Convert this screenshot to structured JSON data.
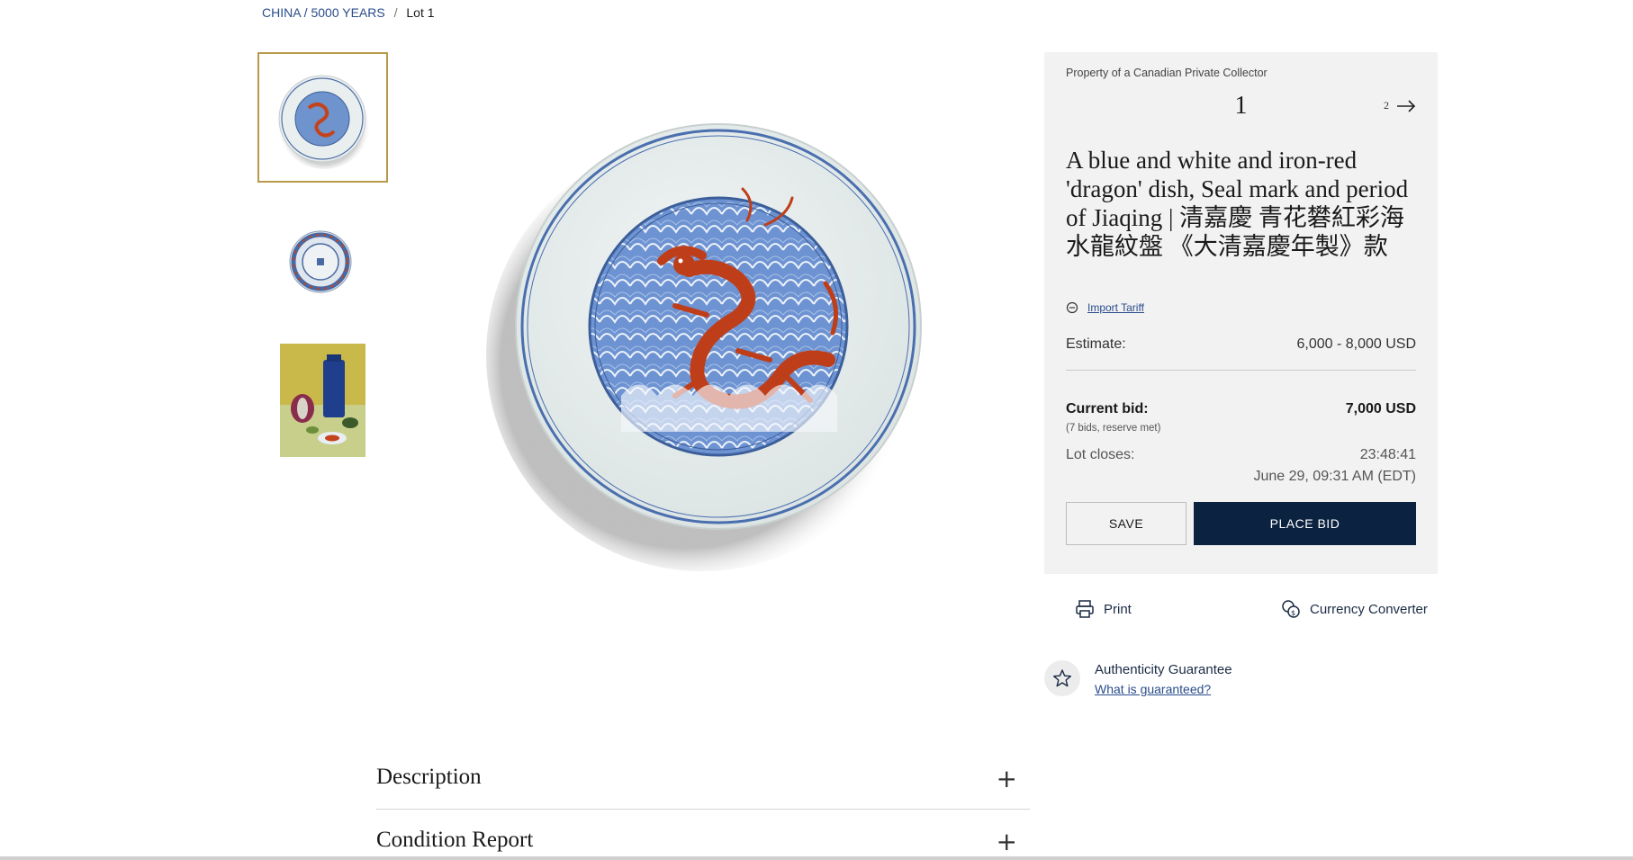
{
  "breadcrumb": {
    "sale": "CHINA / 5000 YEARS",
    "separator": "/",
    "current": "Lot 1"
  },
  "gallery": {
    "thumbnails": [
      {
        "name": "dish-front-thumbnail",
        "selected": true
      },
      {
        "name": "dish-back-thumbnail",
        "selected": false
      },
      {
        "name": "still-life-thumbnail",
        "selected": false
      }
    ]
  },
  "lot": {
    "provenance": "Property of a Canadian Private Collector",
    "number": "1",
    "next_number": "2",
    "title": "A blue and white and iron-red 'dragon' dish, Seal mark and period of Jiaqing | 清嘉慶 青花礬紅彩海水龍紋盤 《大清嘉慶年製》款",
    "import_tariff_label": "Import Tariff",
    "estimate_label": "Estimate:",
    "estimate_value": "6,000 - 8,000 USD",
    "current_bid_label": "Current bid:",
    "current_bid_value": "7,000 USD",
    "bid_meta": "(7 bids, reserve met)",
    "closes_label": "Lot closes:",
    "closes_countdown": "23:48:41",
    "closes_date": "June 29, 09:31 AM (EDT)"
  },
  "buttons": {
    "save": "SAVE",
    "place_bid": "PLACE BID"
  },
  "actions": {
    "print": "Print",
    "currency_converter": "Currency Converter"
  },
  "guarantee": {
    "title": "Authenticity Guarantee",
    "link": "What is guaranteed?"
  },
  "accordions": {
    "description": "Description",
    "condition_report": "Condition Report",
    "expand_symbol": "+"
  },
  "colors": {
    "accent_navy": "#0b2340",
    "link_blue": "#2a4d8c",
    "selected_border": "#b89a4a",
    "panel_bg": "#f2f2f2"
  }
}
